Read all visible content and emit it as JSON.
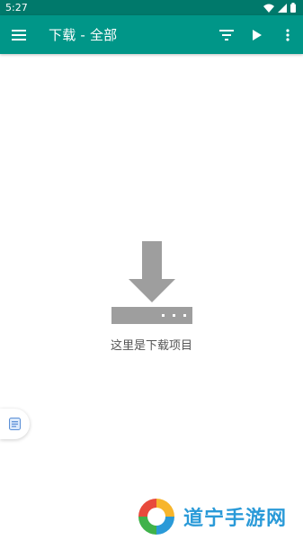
{
  "status_bar": {
    "time": "5:27"
  },
  "app_bar": {
    "title": "下载 - 全部",
    "icons": [
      "menu-icon",
      "filter-icon",
      "play-icon",
      "more-vert-icon"
    ]
  },
  "empty_state": {
    "icon": "download-icon",
    "message": "这里是下载项目"
  },
  "floating_tab": {
    "icon": "note-icon"
  },
  "watermark": {
    "text": "道宁手游网"
  },
  "colors": {
    "status_bar": "#00796b",
    "app_bar": "#009688",
    "empty_icon": "#9e9e9e",
    "watermark_text": "#2a9ad8"
  }
}
